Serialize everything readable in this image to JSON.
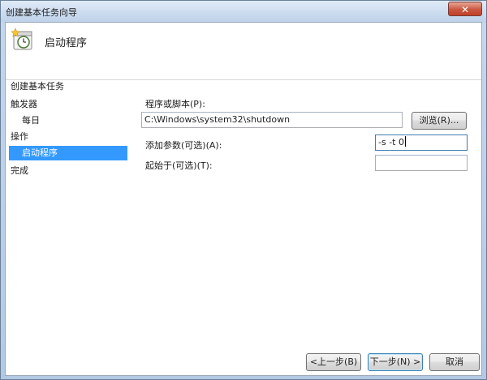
{
  "window": {
    "title": "创建基本任务向导",
    "close_glyph": "✕"
  },
  "header": {
    "title": "启动程序",
    "icon": "task-clock-icon"
  },
  "sidebar": {
    "heading": "创建基本任务",
    "items": [
      {
        "label": "触发器",
        "level": 0,
        "selected": false
      },
      {
        "label": "每日",
        "level": 1,
        "selected": false
      },
      {
        "label": "操作",
        "level": 0,
        "selected": false
      },
      {
        "label": "启动程序",
        "level": 1,
        "selected": true
      },
      {
        "label": "完成",
        "level": 0,
        "selected": false
      }
    ],
    "selected_color": "#3399ff"
  },
  "form": {
    "program_label": "程序或脚本(P):",
    "program_value": "C:\\Windows\\system32\\shutdown",
    "browse_label": "浏览(R)...",
    "args_label": "添加参数(可选)(A):",
    "args_value": "-s -t 0",
    "start_in_label": "起始于(可选)(T):",
    "start_in_value": ""
  },
  "footer": {
    "back_label": "<上一步(B)",
    "next_label": "下一步(N) >",
    "cancel_label": "取消"
  }
}
